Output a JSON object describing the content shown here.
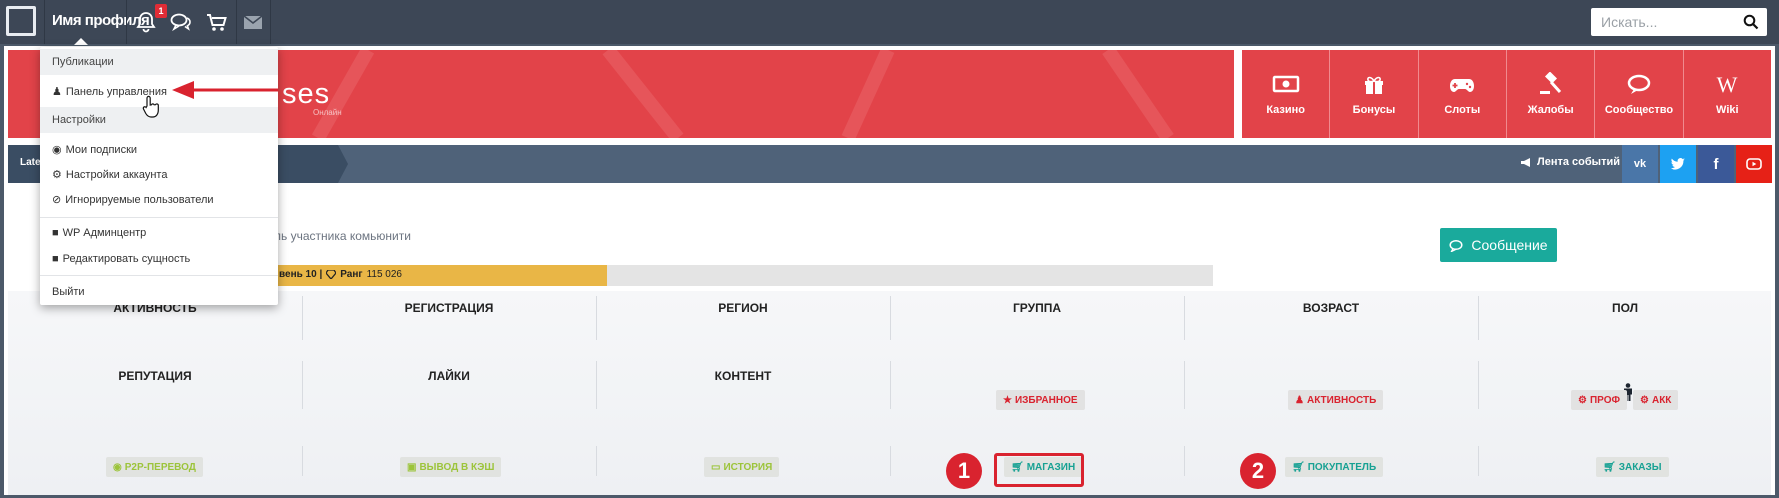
{
  "topbar": {
    "username": "Имя профиля",
    "notification_count": "1",
    "search_placeholder": "Искать..."
  },
  "dropdown": {
    "section_publications": "Публикации",
    "control_panel": "Панель управления",
    "section_settings": "Настройки",
    "my_subscriptions": "Мои подписки",
    "account_settings": "Настройки аккаунта",
    "ignored_users": "Игнорируемые пользователи",
    "wp_admin": "WP Админцентр",
    "edit_entity": "Редактировать сущность",
    "logout": "Выйти"
  },
  "hero": {
    "title_fragment": "ses",
    "subtitle_fragment": "Онлайн"
  },
  "tiles": [
    {
      "label": "Казино",
      "icon": "money-icon"
    },
    {
      "label": "Бонусы",
      "icon": "gift-icon"
    },
    {
      "label": "Слоты",
      "icon": "gamepad-icon"
    },
    {
      "label": "Жалобы",
      "icon": "gavel-icon"
    },
    {
      "label": "Сообщество",
      "icon": "comments-icon"
    },
    {
      "label": "Wiki",
      "icon": "wikipedia-icon"
    }
  ],
  "subbar": {
    "breadcrumb": "Late",
    "feed_label": "Лента событий",
    "social": [
      "vk-icon",
      "twitter-icon",
      "facebook-icon",
      "youtube-icon"
    ]
  },
  "profile": {
    "description_fragment": "ль участника комьюнити",
    "message_button": "Сообщение",
    "level_text": "вень 10 |",
    "rank_label": "Ранг",
    "rank_value": "115 026",
    "progress_fraction": 0.38
  },
  "stats": {
    "row1": [
      "АКТИВНОСТЬ",
      "РЕГИСТРАЦИЯ",
      "РЕГИОН",
      "ГРУППА",
      "ВОЗРАСТ",
      "ПОЛ"
    ],
    "row2": [
      "РЕПУТАЦИЯ",
      "ЛАЙКИ",
      "КОНТЕНТ"
    ],
    "tags_row2": {
      "favorites": "ИЗБРАННОЕ",
      "activity": "АКТИВНОСТЬ",
      "prof": "ПРОФ",
      "akk": "АКК"
    },
    "tags_row3": {
      "p2p": "P2P-ПЕРЕВОД",
      "cash_out": "ВЫВОД В КЭШ",
      "history": "ИСТОРИЯ",
      "shop": "МАГАЗИН",
      "buyer": "ПОКУПАТЕЛЬ",
      "orders": "ЗАКАЗЫ"
    }
  },
  "annotations": {
    "marker1": "1",
    "marker2": "2"
  },
  "colors": {
    "navbar": "#3d4756",
    "brand_red": "#e24349",
    "teal": "#1aaa9c",
    "gold": "#e9b646",
    "vk": "#4a76a8",
    "twitter": "#1da1f2",
    "facebook": "#3b5998",
    "youtube": "#e62117"
  }
}
